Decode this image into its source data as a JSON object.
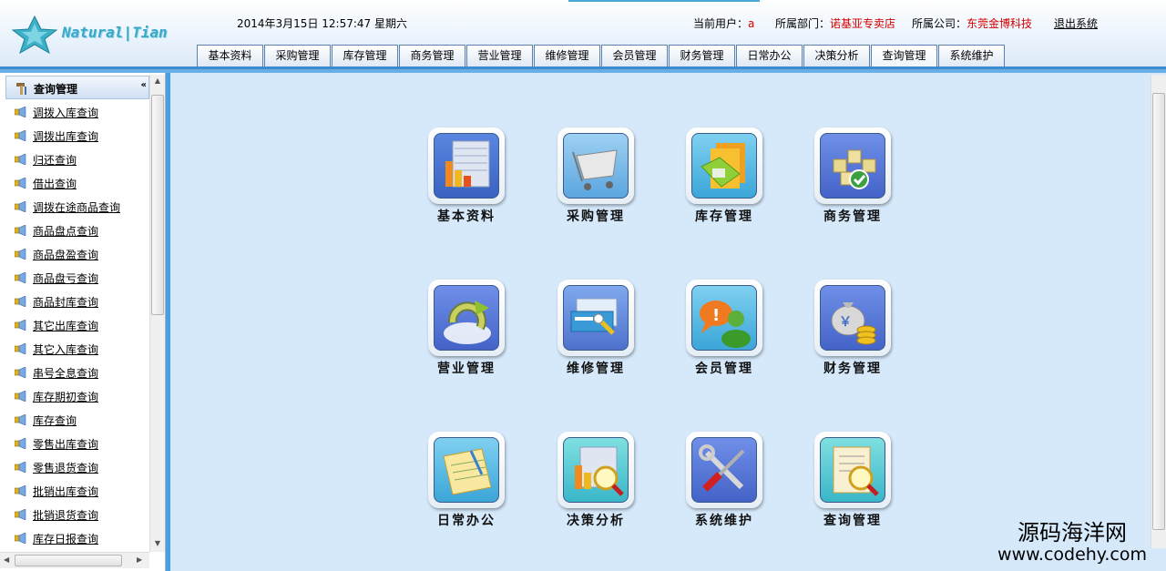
{
  "header": {
    "logo_text": "Natural|Tian",
    "datetime": "2014年3月15日 12:57:47 星期六",
    "current_user_label": "当前用户：",
    "current_user": "a",
    "dept_label": "所属部门：",
    "dept": "诺基亚专卖店",
    "company_label": "所属公司：",
    "company": "东莞金博科技",
    "logout": "退出系统",
    "colors": {
      "accent": "#3f8bd0",
      "highlight": "#d00000"
    }
  },
  "nav": {
    "tabs": [
      {
        "label": "基本资料"
      },
      {
        "label": "采购管理"
      },
      {
        "label": "库存管理"
      },
      {
        "label": "商务管理"
      },
      {
        "label": "营业管理"
      },
      {
        "label": "维修管理"
      },
      {
        "label": "会员管理"
      },
      {
        "label": "财务管理"
      },
      {
        "label": "日常办公"
      },
      {
        "label": "决策分析"
      },
      {
        "label": "查询管理"
      },
      {
        "label": "系统维护"
      }
    ],
    "active": "查询管理"
  },
  "sidebar": {
    "title": "查询管理",
    "title_icon": "hammer-icon",
    "collapse_glyph": "«",
    "item_icon": "speaker-bullet-icon",
    "items": [
      {
        "label": "调拨入库查询"
      },
      {
        "label": "调拨出库查询"
      },
      {
        "label": "归还查询"
      },
      {
        "label": "借出查询"
      },
      {
        "label": "调拨在途商品查询"
      },
      {
        "label": "商品盘点查询"
      },
      {
        "label": "商品盘盈查询"
      },
      {
        "label": "商品盘亏查询"
      },
      {
        "label": "商品封库查询"
      },
      {
        "label": "其它出库查询"
      },
      {
        "label": "其它入库查询"
      },
      {
        "label": "串号全息查询"
      },
      {
        "label": "库存期初查询"
      },
      {
        "label": "库存查询"
      },
      {
        "label": "零售出库查询"
      },
      {
        "label": "零售退货查询"
      },
      {
        "label": "批销出库查询"
      },
      {
        "label": "批销退货查询"
      },
      {
        "label": "库存日报查询"
      }
    ]
  },
  "modules": [
    {
      "label": "基本资料",
      "icon": "bar-chart-icon"
    },
    {
      "label": "采购管理",
      "icon": "shopping-cart-icon"
    },
    {
      "label": "库存管理",
      "icon": "folders-icon"
    },
    {
      "label": "商务管理",
      "icon": "boxes-check-icon"
    },
    {
      "label": "营业管理",
      "icon": "refresh-arrow-icon"
    },
    {
      "label": "维修管理",
      "icon": "repair-card-icon"
    },
    {
      "label": "会员管理",
      "icon": "member-chat-icon"
    },
    {
      "label": "财务管理",
      "icon": "money-bag-icon"
    },
    {
      "label": "日常办公",
      "icon": "notepad-icon"
    },
    {
      "label": "决策分析",
      "icon": "analysis-magnifier-icon"
    },
    {
      "label": "系统维护",
      "icon": "tools-icon"
    },
    {
      "label": "查询管理",
      "icon": "document-search-icon"
    }
  ],
  "watermark": {
    "cn": "源码海洋网",
    "url": "www.codehy.com"
  }
}
